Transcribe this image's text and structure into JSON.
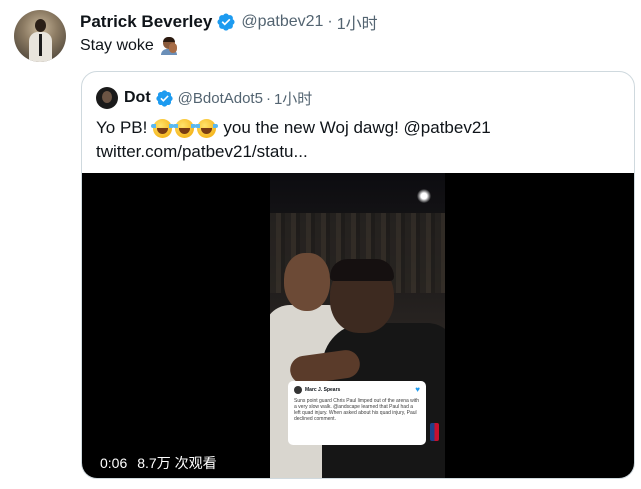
{
  "tweet": {
    "author_name": "Patrick Beverley",
    "author_handle": "@patbev21",
    "separator": "·",
    "time": "1小时",
    "text": "Stay woke",
    "emoji_icon": "person-facepalming-emoji"
  },
  "quoted": {
    "author_name": "Dot",
    "author_handle": "@BdotAdot5",
    "separator": "·",
    "time": "1小时",
    "line1_start": "Yo PB!",
    "line1_emojis": [
      "face-with-tears-of-joy-emoji",
      "face-with-tears-of-joy-emoji",
      "face-with-tears-of-joy-emoji"
    ],
    "line1_end": "you the new Woj dawg! @patbev21",
    "line2": "twitter.com/patbev21/statu...",
    "video": {
      "duration": "0:06",
      "views": "8.7万 次观看",
      "embedded_tweet_name": "Marc J. Spears",
      "embedded_tweet_text": "Suns point guard Chris Paul limped out of the arena with a very slow walk. @andscape learned that Paul had a left quad injury. When asked about his quad injury, Paul declined comment."
    }
  },
  "colors": {
    "verified": "#1d9bf0",
    "secondary_text": "#536471",
    "border": "#cfd9de"
  }
}
